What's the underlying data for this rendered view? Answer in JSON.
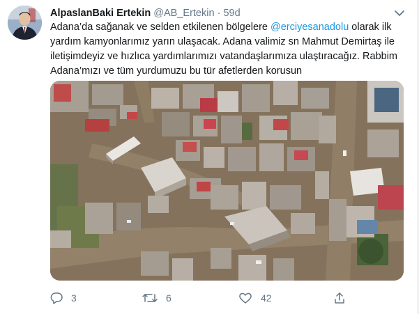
{
  "tweet": {
    "author": {
      "name": "AlpaslanBaki Ertekin",
      "handle": "@AB_Ertekin",
      "separator": "·",
      "time": "59d"
    },
    "text_parts": {
      "p1": "Adana’da sağanak ve selden etkilenen bölgelere ",
      "mention": "@erciyesanadolu",
      "p2": " olarak ilk yardım kamyonlarımız yarın ulaşacak. Adana valimiz sn Mahmut Demirtaş ile iletişimdeyiz ve hızlıca yardımlarımızı vatandaşlarımıza ulaştıracağız. Rabbim Adana’mızı ve tüm yurdumuzu bu tür afetlerden korusun"
    },
    "media": {
      "kind": "aerial-flood-photo"
    },
    "actions": {
      "reply_count": "3",
      "retweet_count": "6",
      "like_count": "42"
    },
    "colors": {
      "accent": "#1b95e0",
      "muted": "#657786",
      "text": "#14171a",
      "flood_water": "#8a7459"
    },
    "icons": [
      "chevron-down-icon",
      "reply-icon",
      "retweet-icon",
      "like-icon",
      "share-icon"
    ]
  }
}
